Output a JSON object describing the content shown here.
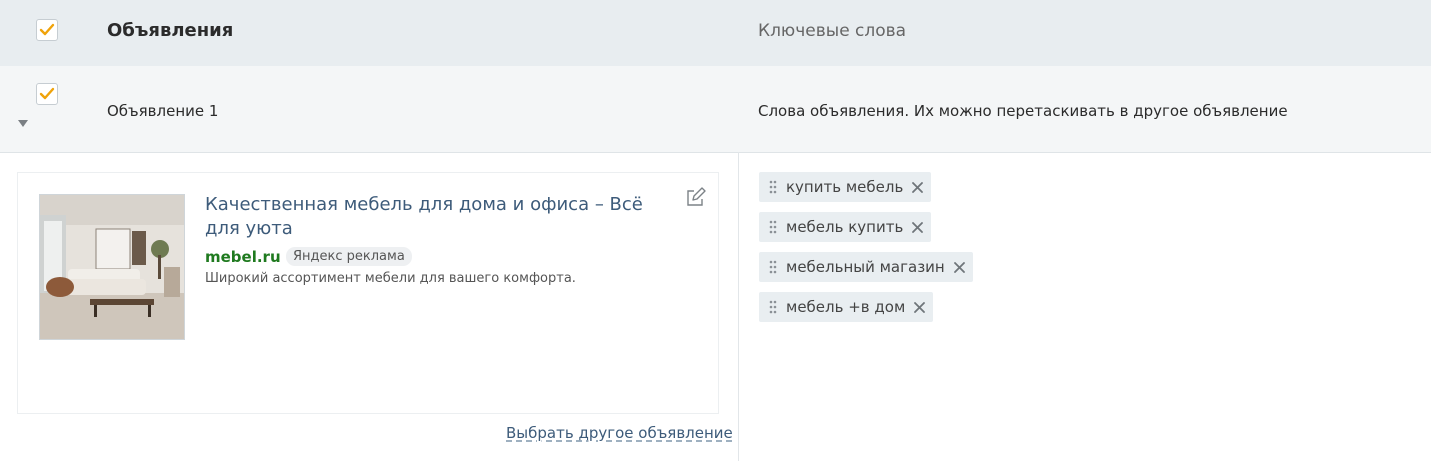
{
  "header": {
    "title": "Объявления",
    "keywords_title": "Ключевые слова"
  },
  "ad_row": {
    "name": "Объявление 1",
    "words_hint": "Слова объявления. Их можно перетаскивать в другое объявление"
  },
  "ad_preview": {
    "headline": "Качественная мебель для дома и офиса – Всё для уюта",
    "domain": "mebel.ru",
    "badge": "Яндекс реклама",
    "description": "Широкий ассортимент мебели для вашего комфорта."
  },
  "choose_other_link": "Выбрать другое объявление",
  "keywords": [
    {
      "text": "купить мебель"
    },
    {
      "text": "мебель купить"
    },
    {
      "text": "мебельный магазин"
    },
    {
      "text": "мебель +в дом"
    }
  ],
  "colors": {
    "check": "#f0a30a",
    "link": "#3d5b7a",
    "domain": "#1f7a1f"
  },
  "icons": [
    "checkmark-icon",
    "expand-triangle-icon",
    "edit-icon",
    "drag-handle-icon",
    "remove-icon"
  ]
}
